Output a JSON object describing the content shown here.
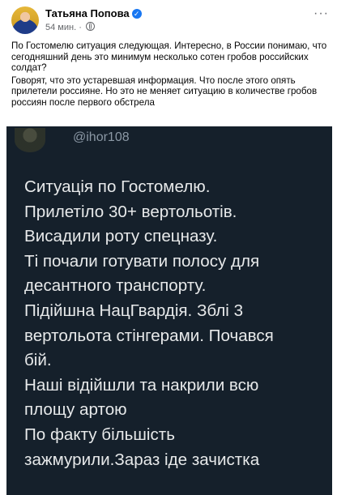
{
  "post": {
    "author": "Татьяна Попова",
    "verified_mark": "✓",
    "timestamp": "54 мин.",
    "separator": "·",
    "menu": "···",
    "paragraphs": [
      "По Гостомелю ситуация следующая. Интересно, в России понимаю, что сегодняшний день это минимум несколько сотен гробов российских солдат?",
      "Говорят, что это устаревшая информация. Что после этого опять прилетели россияне. Но это не меняет ситуацию в количестве гробов россиян после первого обстрела"
    ],
    "icons": {
      "privacy": "globe-icon",
      "menu": "more-icon"
    },
    "accent": "#1877f2"
  },
  "tweet_image": {
    "handle": "@ihor108",
    "lines": [
      "Ситуація по Гостомелю.",
      "Прилетіло 30+ вертольотів.",
      "Висадили роту спецназу.",
      "Ті почали готувати полосу для",
      "десантного транспорту.",
      "Підійшна НацГвардія. Зблі 3",
      "вертольота стінгерами. Почався",
      "бій.",
      "Наші відійшли та накрили всю",
      "площу артою",
      "По факту більшість",
      "зажмурили.Зараз іде зачистка"
    ],
    "background": "#15202b"
  }
}
